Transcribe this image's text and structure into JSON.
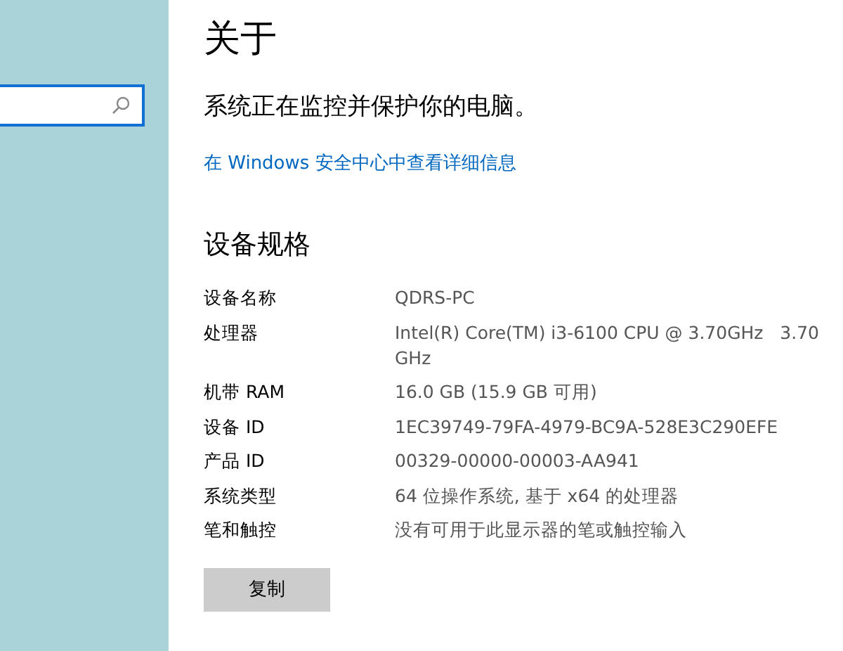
{
  "search": {
    "focused": true
  },
  "page": {
    "title": "关于",
    "status": "系统正在监控并保护你的电脑。",
    "link": "在 Windows 安全中心中查看详细信息"
  },
  "specs": {
    "heading": "设备规格",
    "rows": [
      {
        "label": "设备名称",
        "value": "QDRS-PC"
      },
      {
        "label": "处理器",
        "value": "Intel(R) Core(TM) i3-6100 CPU @ 3.70GHz   3.70 GHz"
      },
      {
        "label": "机带 RAM",
        "value": "16.0 GB (15.9 GB 可用)"
      },
      {
        "label": "设备 ID",
        "value": "1EC39749-79FA-4979-BC9A-528E3C290EFE"
      },
      {
        "label": "产品 ID",
        "value": "00329-00000-00003-AA941"
      },
      {
        "label": "系统类型",
        "value": "64 位操作系统, 基于 x64 的处理器"
      },
      {
        "label": "笔和触控",
        "value": "没有可用于此显示器的笔或触控输入"
      }
    ],
    "button": "复制"
  }
}
